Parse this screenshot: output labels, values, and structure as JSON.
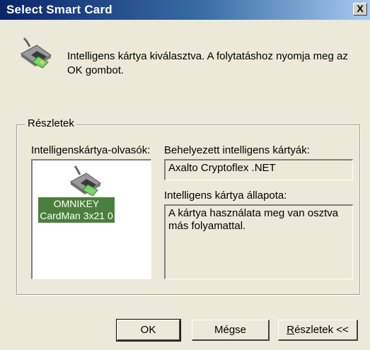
{
  "window": {
    "title": "Select Smart Card",
    "close_label": "X"
  },
  "message": "Intelligens kártya kiválasztva. A folytatáshoz nyomja meg az OK gombot.",
  "details": {
    "group_title": "Részletek",
    "readers_label": "Intelligenskártya-olvasók:",
    "reader_name": "OMNIKEY CardMan 3x21 0",
    "inserted_cards_label": "Behelyezett intelligens kártyák:",
    "inserted_card_value": "Axalto Cryptoflex .NET",
    "status_label": "Intelligens kártya állapota:",
    "status_value": "A kártya használata meg van osztva más folyamattal."
  },
  "buttons": {
    "ok": "OK",
    "cancel": "Mégse",
    "details": "Részletek <<"
  },
  "colors": {
    "titlebar_start": "#0a246a",
    "titlebar_end": "#a6caf0",
    "selected_reader": "#4b7f3d"
  }
}
